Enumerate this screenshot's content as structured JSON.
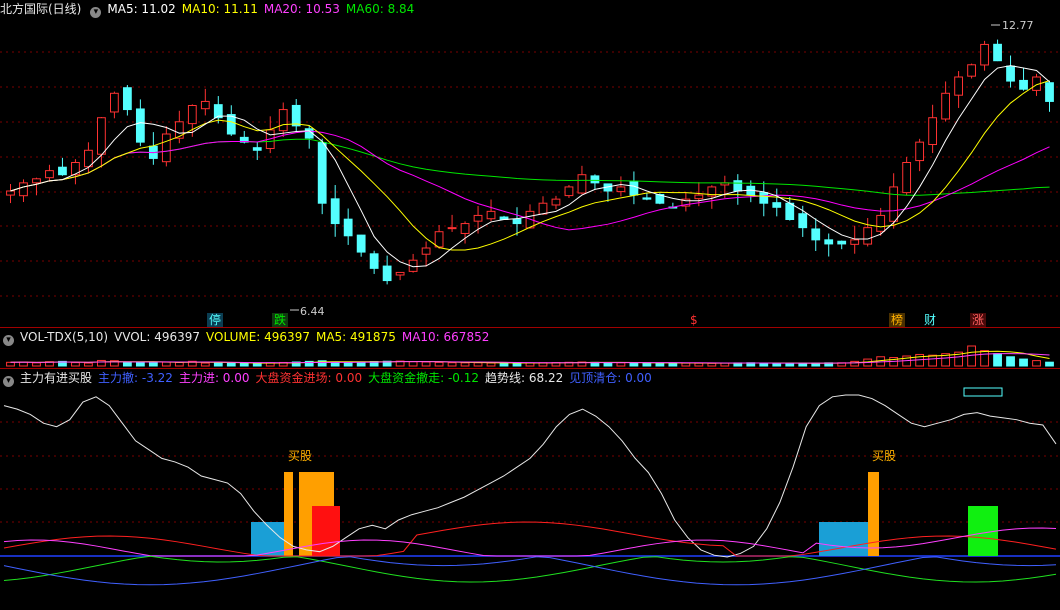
{
  "main": {
    "legend_name": "北方国际(日线)",
    "ma5": "MA5: 11.02",
    "ma10": "MA10: 11.11",
    "ma20": "MA20: 10.53",
    "ma60": "MA60: 8.84",
    "high_label": "12.77",
    "low_label": "6.44",
    "markers": [
      "停",
      "跌",
      "$",
      "榜",
      "财",
      "涨"
    ]
  },
  "volume": {
    "name": "VOL-TDX(5,10)",
    "vvol": "VVOL: 496397",
    "volume": "VOLUME: 496397",
    "ma5": "MA5: 491875",
    "ma10": "MA10: 667852"
  },
  "indicator": {
    "name": "主力有进买股",
    "items": [
      "主力撤: -3.22",
      "主力进: 0.00",
      "大盘资金进场: 0.00",
      "大盘资金撤走: -0.12",
      "趋势线: 68.22",
      "见顶清仓: 0.00"
    ],
    "buy_label_1": "买股",
    "buy_label_2": "买股"
  },
  "colors": {
    "up": "#ff3232",
    "down": "#54ffff",
    "ma5": "#ffffff",
    "ma10": "#ffff00",
    "ma20": "#ff00ff",
    "ma60": "#00e600",
    "grid": "#7a0000"
  },
  "chart_data": {
    "type": "candlestick",
    "period": "daily",
    "price_range": [
      6.0,
      13.0
    ],
    "high_point": 12.77,
    "low_point": 6.44,
    "ma_latest": {
      "MA5": 11.02,
      "MA10": 11.11,
      "MA20": 10.53,
      "MA60": 8.84
    },
    "close_series": [
      8.8,
      9.0,
      9.1,
      9.3,
      9.2,
      9.5,
      9.8,
      10.6,
      11.2,
      10.8,
      10.0,
      9.6,
      10.2,
      10.5,
      10.9,
      11.0,
      10.6,
      10.2,
      10.0,
      9.8,
      10.3,
      10.8,
      10.4,
      10.1,
      8.5,
      8.0,
      7.7,
      7.3,
      6.9,
      6.6,
      6.8,
      7.1,
      7.4,
      7.8,
      7.9,
      8.0,
      8.2,
      8.3,
      8.1,
      8.0,
      8.3,
      8.5,
      8.6,
      8.9,
      9.2,
      9.0,
      8.8,
      8.9,
      8.7,
      8.6,
      8.5,
      8.4,
      8.6,
      8.7,
      8.9,
      9.0,
      8.8,
      8.7,
      8.5,
      8.4,
      8.1,
      7.9,
      7.6,
      7.5,
      7.5,
      7.6,
      7.9,
      8.2,
      8.9,
      9.5,
      10.0,
      10.6,
      11.2,
      11.6,
      11.9,
      12.4,
      12.0,
      11.5,
      11.3,
      11.6,
      11.0
    ],
    "volume_series": [
      480000,
      520000,
      410000,
      560000,
      600000,
      440000,
      380000,
      720000,
      690000,
      510000,
      430000,
      470000,
      500000,
      455000,
      610000,
      380000,
      420000,
      390000,
      350000,
      330000,
      410000,
      460000,
      520000,
      600000,
      680000,
      530000,
      470000,
      510000,
      580000,
      620000,
      640000,
      560000,
      520000,
      470000,
      430000,
      410000,
      420000,
      390000,
      380000,
      370000,
      400000,
      430000,
      450000,
      480000,
      520000,
      470000,
      440000,
      420000,
      400000,
      410000,
      390000,
      380000,
      370000,
      360000,
      350000,
      380000,
      400000,
      420000,
      390000,
      360000,
      350000,
      340000,
      380000,
      410000,
      420000,
      600000,
      900000,
      1200000,
      1100000,
      1300000,
      1500000,
      1400000,
      1600000,
      1800000,
      2600000,
      2000000,
      1600000,
      1200000,
      900000,
      700000,
      496397
    ],
    "indicator_series": {
      "趋势线": [
        90,
        88,
        85,
        80,
        78,
        82,
        92,
        95,
        90,
        80,
        70,
        65,
        60,
        58,
        55,
        50,
        48,
        46,
        40,
        30,
        22,
        15,
        10,
        8,
        7,
        10,
        15,
        20,
        22,
        20,
        25,
        28,
        30,
        32,
        35,
        38,
        42,
        46,
        50,
        55,
        60,
        68,
        78,
        85,
        88,
        84,
        78,
        70,
        60,
        52,
        40,
        25,
        15,
        8,
        5,
        4,
        6,
        10,
        20,
        35,
        55,
        78,
        90,
        95,
        96,
        96,
        94,
        90,
        85,
        80,
        78,
        80,
        82,
        85,
        86,
        84,
        83,
        82,
        80,
        79,
        68.22
      ],
      "主力撤": [
        -3,
        -2,
        -4,
        -6,
        -8,
        -10,
        -5,
        -2,
        -3,
        -6,
        -8,
        -12,
        -14,
        -18,
        -20,
        -22,
        -25,
        -28,
        -24,
        -18,
        -12,
        -10,
        -14,
        -12,
        -8,
        -5,
        -3,
        -2,
        -4,
        -6,
        -5,
        -4,
        -3,
        -2,
        -3,
        -4,
        -5,
        -6,
        -7,
        -6,
        -5,
        -4,
        -6,
        -8,
        -10,
        -12,
        -14,
        -16,
        -18,
        -20,
        -18,
        -15,
        -12,
        -10,
        -8,
        -6,
        -4,
        -6,
        -5,
        -3.22
      ],
      "大盘资金撤走": [
        -0.2,
        -0.5,
        -0.8,
        -1.2,
        -0.6,
        -0.3,
        -0.2,
        -0.4,
        -0.6,
        -0.8,
        -0.5,
        -0.3,
        -0.2,
        -0.1,
        -0.12
      ]
    },
    "buy_signals": [
      "买股",
      "买股"
    ]
  }
}
